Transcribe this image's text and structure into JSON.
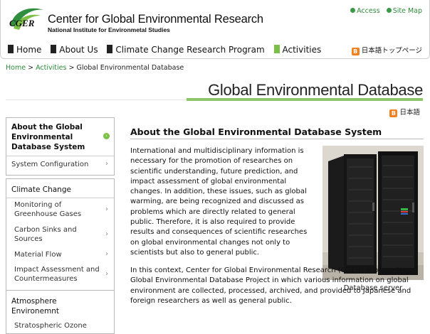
{
  "header": {
    "logo_text": "CGER",
    "org_title": "Center for Global Environmental Research",
    "org_subtitle": "National Institute for Environmetal Studies",
    "top_links": [
      "Access",
      "Site Map"
    ],
    "nav": [
      {
        "label": "Home",
        "active": false
      },
      {
        "label": "About Us",
        "active": false
      },
      {
        "label": "Climate Change Research Program",
        "active": false
      },
      {
        "label": "Activities",
        "active": true
      }
    ],
    "jp_top_label": "日本語トップページ",
    "b_icon": "B"
  },
  "breadcrumb": {
    "home": "Home",
    "sep1": ">",
    "activities": "Activities",
    "sep2": ">",
    "current": "Global Environmental Database"
  },
  "page_title": "Global Environmental Database",
  "jp_label": "日本語",
  "sidebar": {
    "box1": {
      "heading": "About the Global Environmental Database System",
      "items": [
        {
          "label": "System Configuration"
        }
      ]
    },
    "box2": {
      "heading": "Climate Change",
      "items": [
        {
          "label": "Monitoring of Greenhouse Gases"
        },
        {
          "label": "Carbon Sinks and Sources"
        },
        {
          "label": "Material Flow"
        },
        {
          "label": "Impact Assessment and Countermeasures"
        }
      ]
    },
    "box3": {
      "heading": "Atmosphere Environemnt",
      "items": [
        {
          "label": "Stratospheric Ozone"
        }
      ]
    },
    "chevron": "›"
  },
  "main": {
    "section_title": "About the Global Environmental Database System",
    "paragraph1": "International and multidisciplinary information is necessary for the promotion of researches on scientific understanding, future prediction, and impact assessment of global environmental changes. In addition, these issues, such as global warming, are being recognized and discussed as problems which are directly related to general public. Therefore, it is also required to provide results and consequences of scientific researches on global environmental changes not only to scientists but also to general public.",
    "paragraph2": "In this context, Center for Global Environmental Research (CGER) is promoting Global Environmental Database Project in which various information on global environment are collected, processed, archived, and provided to Japanese and foreign researchers as well as general public.",
    "photo_caption": "Database server"
  },
  "colors": {
    "accent_green": "#7bbf44",
    "link_green": "#2c8a3a",
    "orange": "#f08020"
  }
}
